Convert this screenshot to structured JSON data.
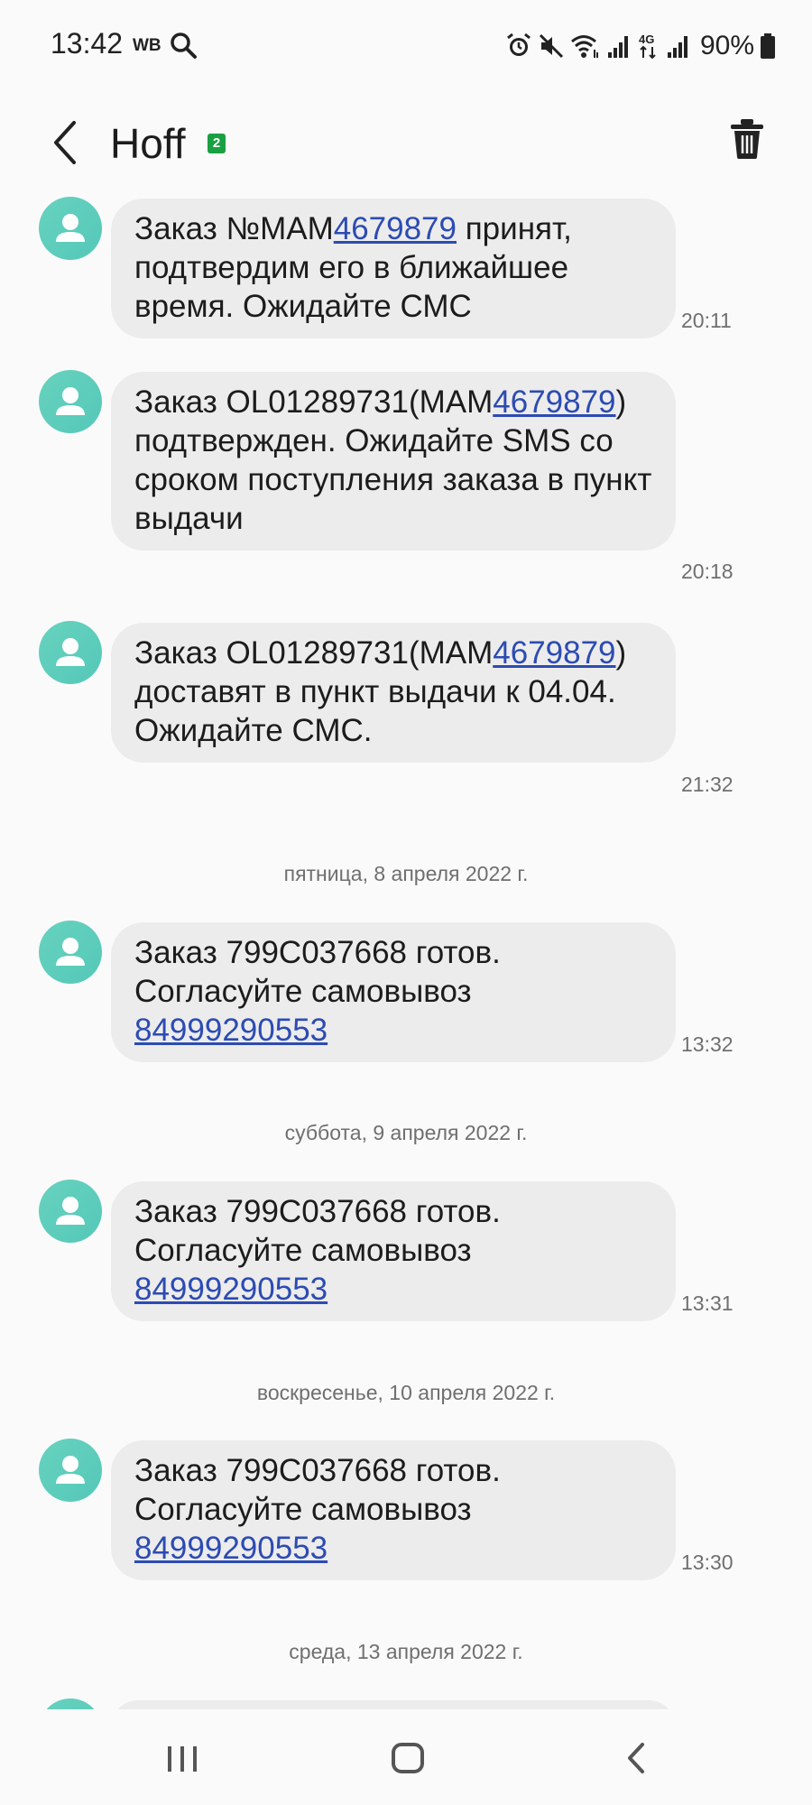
{
  "status_bar": {
    "time": "13:42",
    "carrier_tag": "WB",
    "network": "4G",
    "battery": "90%"
  },
  "header": {
    "title": "Hoff",
    "sim_badge": "2"
  },
  "messages": [
    {
      "pre": "Заказ №MAM",
      "link": "4679879",
      "post": " принят, подтвердим его в ближайшее время. Ожидайте СМС",
      "time": "20:11"
    },
    {
      "pre": "Заказ OL01289731(MAM",
      "link": "4679879",
      "post": ") подтвержден. Ожидайте SMS со сроком поступления заказа в пункт выдачи",
      "time": "20:18"
    },
    {
      "pre": "Заказ OL01289731(MAM",
      "link": "4679879",
      "post": ") доставят в пункт выдачи к 04.04. Ожидайте СМС.",
      "time": "21:32"
    },
    {
      "pre": "Заказ 799C037668 готов. Согласуйте самовывоз ",
      "link": "84999290553",
      "post": "",
      "time": "13:32"
    },
    {
      "pre": "Заказ 799C037668 готов. Согласуйте самовывоз ",
      "link": "84999290553",
      "post": "",
      "time": "13:31"
    },
    {
      "pre": "Заказ 799C037668 готов. Согласуйте самовывоз ",
      "link": "84999290553",
      "post": "",
      "time": "13:30"
    }
  ],
  "date_separators": [
    "пятница, 8 апреля 2022 г.",
    "суббота, 9 апреля 2022 г.",
    "воскресенье, 10 апреля 2022 г.",
    "среда, 13 апреля 2022 г."
  ],
  "icons": {
    "back": "chevron-left-icon",
    "delete": "trash-icon",
    "nav_recents": "recents-icon",
    "nav_home": "home-icon",
    "nav_back": "back-icon"
  },
  "colors": {
    "avatar": "#5ecdbb",
    "bubble": "#ececec",
    "link": "#2c4bb3",
    "sim_badge": "#1aa042"
  }
}
